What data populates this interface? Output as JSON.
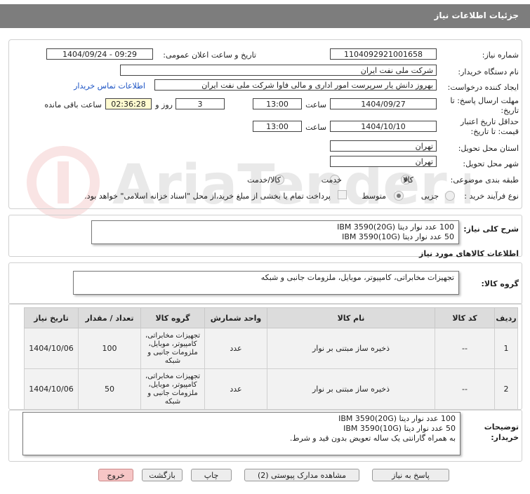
{
  "header": {
    "title": "جزئیات اطلاعات نیاز"
  },
  "fields": {
    "need_number_label": "شماره نیاز:",
    "need_number": "1104092921001658",
    "announce_label": "تاریخ و ساعت اعلان عمومی:",
    "announce_value": "1404/09/24 - 09:29",
    "buyer_label": "نام دستگاه خریدار:",
    "buyer_value": "شرکت ملی نفت ایران",
    "requester_label": "ایجاد کننده درخواست:",
    "requester_value": "بهروز دانش یار سرپرست امور اداری و مالی فاوا شرکت ملی نفت ایران",
    "contact_link": "اطلاعات تماس خریدار",
    "deadline_label_1": "مهلت ارسال پاسخ: تا",
    "deadline_label_2": "تاریخ:",
    "deadline_date": "1404/09/27",
    "time_label": "ساعت",
    "deadline_time": "13:00",
    "days_value": "3",
    "days_label": "روز و",
    "remaining_time": "02:36:28",
    "remaining_label": "ساعت باقی مانده",
    "validity_label_1": "حداقل تاریخ اعتبار",
    "validity_label_2": "قیمت: تا تاریخ:",
    "validity_date": "1404/10/10",
    "validity_time": "13:00",
    "province_label": "استان محل تحویل:",
    "province_value": "تهران",
    "city_label": "شهر محل تحویل:",
    "city_value": "تهران",
    "category_label": "طبقه بندی موضوعی:",
    "category_options": [
      "کالا",
      "خدمت",
      "کالا/خدمت"
    ],
    "process_label": "نوع فرآیند خرید :",
    "process_options": [
      "جزیی",
      "متوسط"
    ],
    "payment_note": "پرداخت تمام یا بخشی از مبلغ خرید،از محل \"اسناد خزانه اسلامی\" خواهد بود."
  },
  "summary": {
    "label": "شرح کلی نیاز:",
    "line1": "100 عدد نوار دیتا IBM 3590(20G)",
    "line2": "50 عدد نوار دیتا IBM 3590(10G)"
  },
  "goods_info_title": "اطلاعات کالاهای مورد نیاز",
  "goods_group": {
    "label": "گروه کالا:",
    "value": "تجهیزات مخابراتی، کامپیوتر، موبایل، ملزومات جانبی و شبکه"
  },
  "table": {
    "headers": [
      "ردیف",
      "کد کالا",
      "نام کالا",
      "واحد شمارش",
      "گروه کالا",
      "تعداد / مقدار",
      "تاریخ نیاز"
    ],
    "rows": [
      [
        "1",
        "--",
        "ذخیره ساز مبتنی بر نوار",
        "عدد",
        "تجهیزات مخابراتی، کامپیوتر، موبایل، ملزومات جانبی و شبکه",
        "100",
        "1404/10/06"
      ],
      [
        "2",
        "--",
        "ذخیره ساز مبتنی بر نوار",
        "عدد",
        "تجهیزات مخابراتی، کامپیوتر، موبایل، ملزومات جانبی و شبکه",
        "50",
        "1404/10/06"
      ]
    ]
  },
  "buyer_notes": {
    "label_1": "توضیحات",
    "label_2": "خریدار:",
    "line1": "100 عدد نوار دیتا IBM 3590(20G)",
    "line2": "50 عدد نوار دیتا IBM 3590(10G)",
    "line3": "به همراه گارانتی یک ساله تعویض بدون قید و شرط."
  },
  "buttons": {
    "reply": "پاسخ به نیاز",
    "docs": "مشاهده مدارک پیوستی (2)",
    "print": "چاپ",
    "back": "بازگشت",
    "exit": "خروج"
  },
  "watermark": {
    "text": "AriaTender.neT"
  },
  "colors": {
    "header_bg": "#7d7d7d",
    "link": "#1a52c4",
    "exit_bg": "#f6c6c6",
    "highlight": "#fffbd0"
  }
}
